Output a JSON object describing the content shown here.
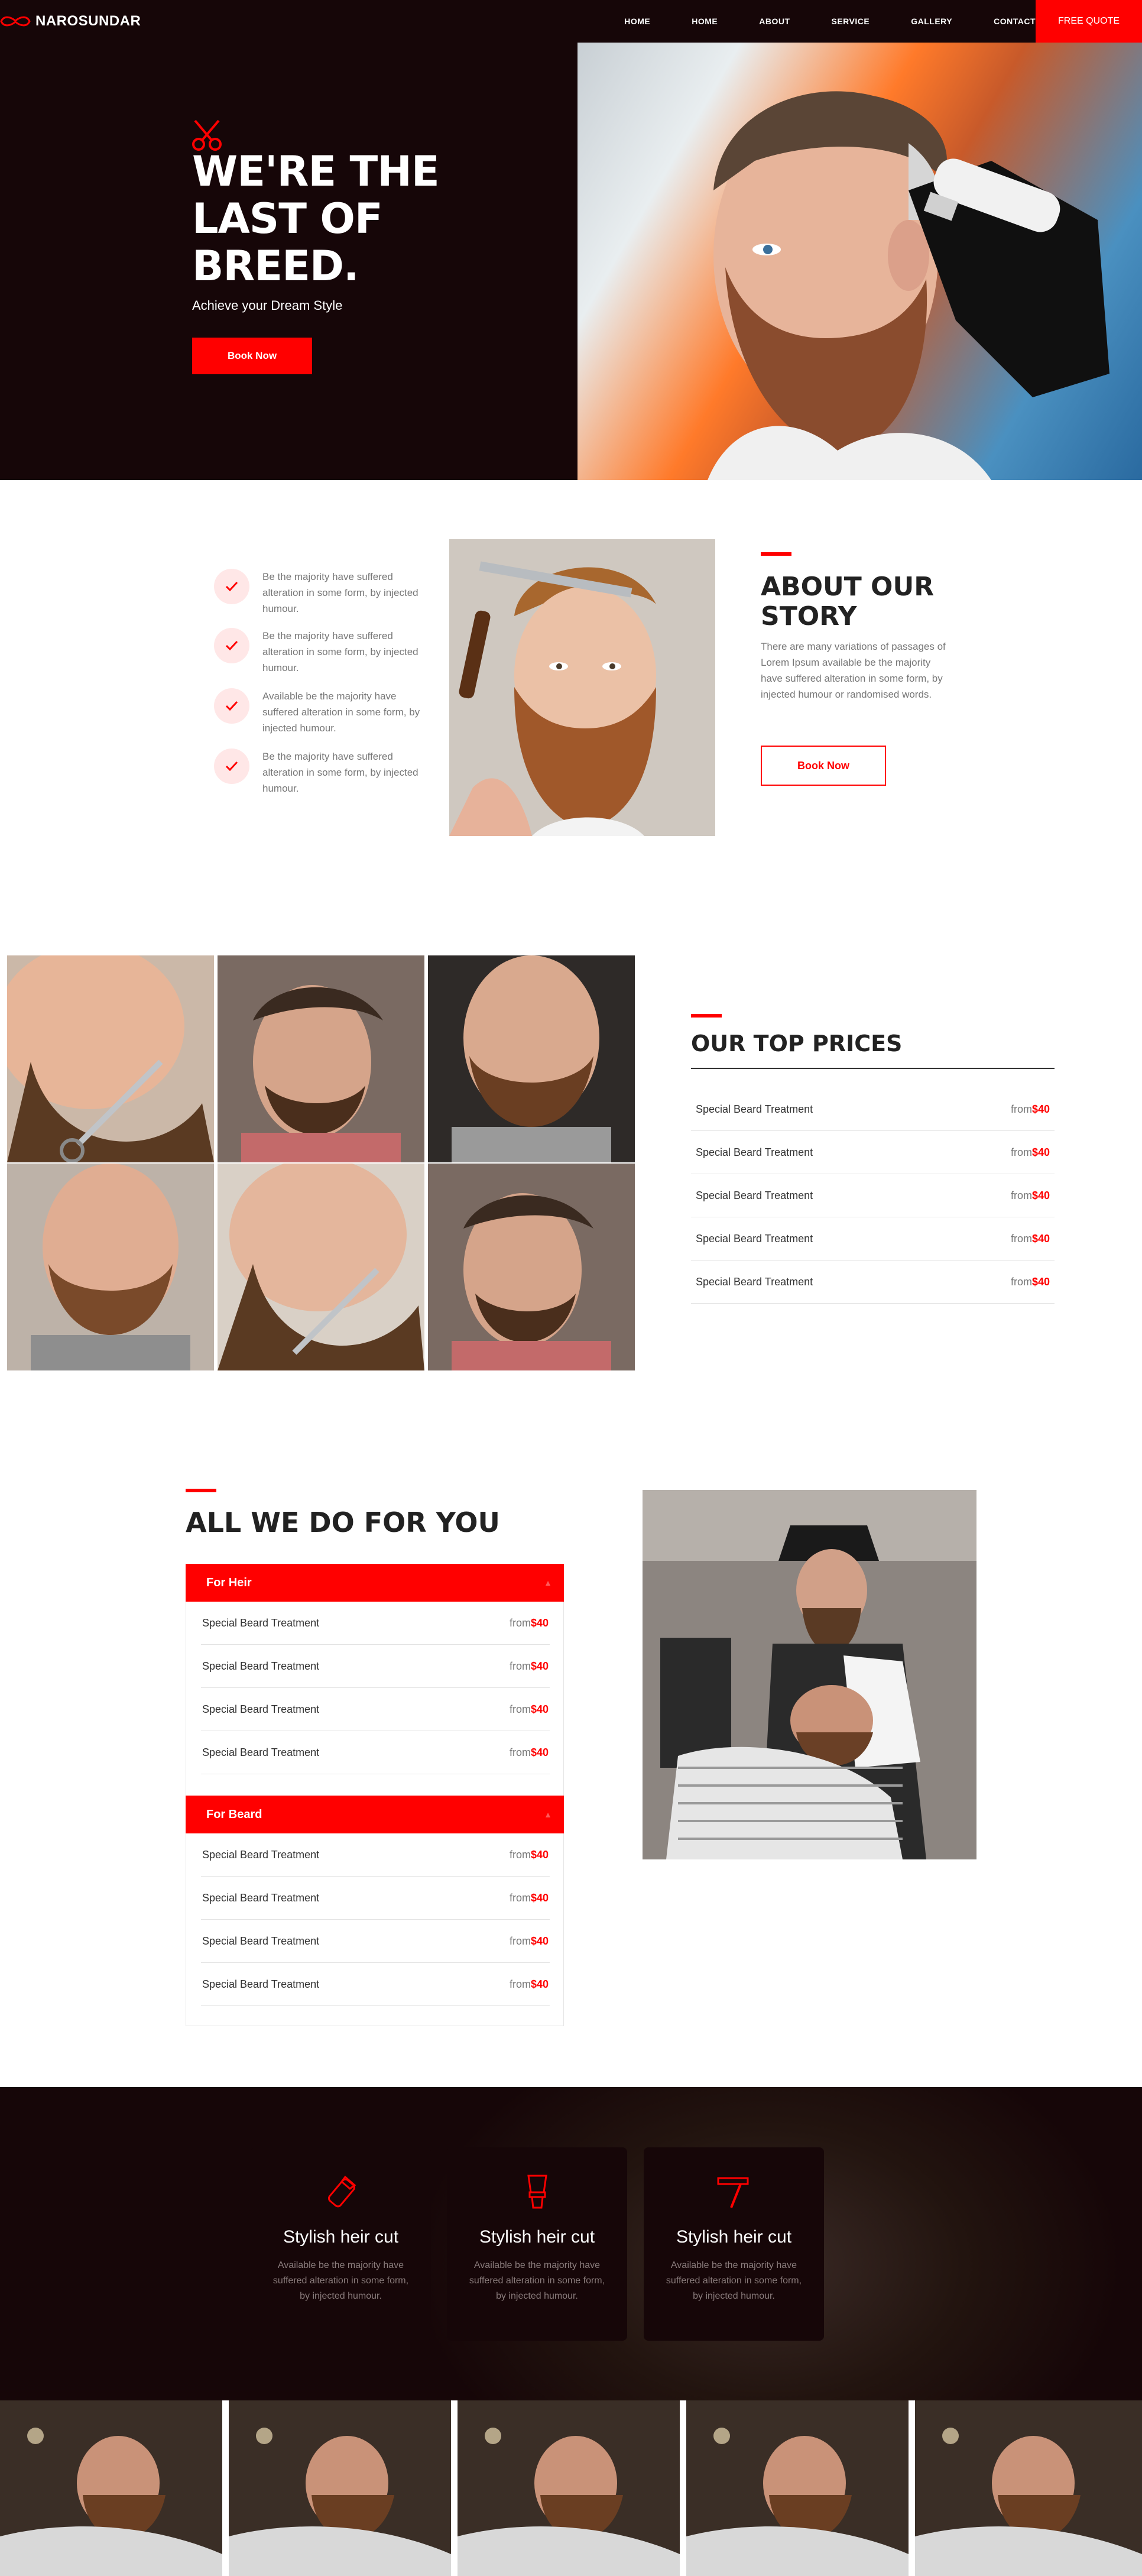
{
  "brand": {
    "name": "NAROSUNDAR"
  },
  "nav": {
    "items": [
      "HOME",
      "HOME",
      "ABOUT",
      "SERVICE",
      "GALLERY",
      "CONTACT"
    ],
    "quote_label": "FREE QUOTE"
  },
  "hero": {
    "title": "WE'RE THE LAST OF BREED.",
    "subtitle": "Achieve your Dream Style",
    "button_label": "Book Now"
  },
  "about": {
    "features": [
      "Be the majority have suffered alteration in some form, by injected humour.",
      "Be the majority have suffered alteration in some form, by injected humour.",
      "Available be the majority have suffered alteration in some form, by injected humour.",
      "Be the majority have suffered alteration in some form, by injected humour."
    ],
    "title": "ABOUT OUR STORY",
    "text": "There are many variations of passages of Lorem Ipsum available be the majority have suffered alteration in some form, by injected humour or randomised words.",
    "button_label": "Book Now"
  },
  "prices": {
    "title": "OUR TOP PRICES",
    "rows": [
      {
        "name": "Special Beard Treatment",
        "from": "from",
        "price": "$40"
      },
      {
        "name": "Special Beard Treatment",
        "from": "from",
        "price": "$40"
      },
      {
        "name": "Special Beard Treatment",
        "from": "from",
        "price": "$40"
      },
      {
        "name": "Special Beard Treatment",
        "from": "from",
        "price": "$40"
      },
      {
        "name": "Special Beard Treatment",
        "from": "from",
        "price": "$40"
      }
    ]
  },
  "services": {
    "title": "ALL WE DO FOR YOU",
    "groups": [
      {
        "heading": "For Heir",
        "rows": [
          {
            "name": "Special Beard Treatment",
            "from": "from",
            "price": "$40"
          },
          {
            "name": "Special Beard Treatment",
            "from": "from",
            "price": "$40"
          },
          {
            "name": "Special Beard Treatment",
            "from": "from",
            "price": "$40"
          },
          {
            "name": "Special Beard Treatment",
            "from": "from",
            "price": "$40"
          }
        ]
      },
      {
        "heading": "For Beard",
        "rows": [
          {
            "name": "Special Beard Treatment",
            "from": "from",
            "price": "$40"
          },
          {
            "name": "Special Beard Treatment",
            "from": "from",
            "price": "$40"
          },
          {
            "name": "Special Beard Treatment",
            "from": "from",
            "price": "$40"
          },
          {
            "name": "Special Beard Treatment",
            "from": "from",
            "price": "$40"
          }
        ]
      }
    ]
  },
  "cards": [
    {
      "icon": "trimmer-icon",
      "title": "Stylish heir cut",
      "text": "Available be the majority have suffered alteration in some form, by injected humour."
    },
    {
      "icon": "shaving-brush-icon",
      "title": "Stylish heir cut",
      "text": "Available be the majority have suffered alteration in some form, by injected humour."
    },
    {
      "icon": "razor-icon",
      "title": "Stylish heir cut",
      "text": "Available be the majority have suffered alteration in some form, by injected humour."
    }
  ],
  "colors": {
    "accent": "#ff0000",
    "dark": "#160608",
    "muted_text": "#777777"
  }
}
